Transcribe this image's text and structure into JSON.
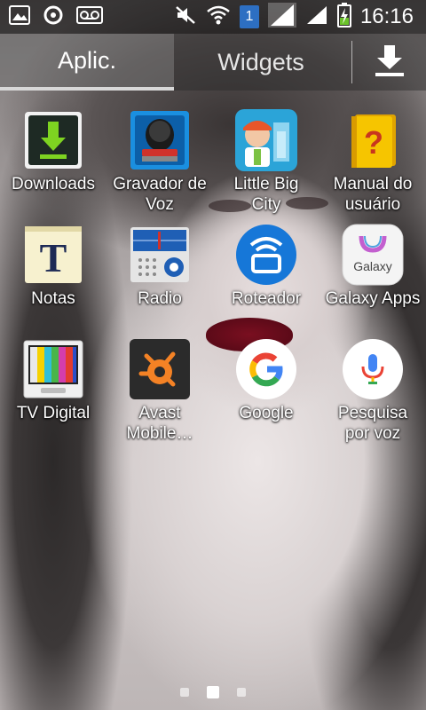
{
  "status_bar": {
    "time": "16:16",
    "sim_slot": "1",
    "icons": [
      "gallery-icon",
      "sync-icon",
      "voicemail-icon",
      "mute-icon",
      "wifi-icon",
      "signal-icon",
      "battery-charging-icon"
    ]
  },
  "tabs": {
    "apps": "Aplic.",
    "widgets": "Widgets",
    "download_icon": "download-icon"
  },
  "apps": [
    {
      "label": "Downloads",
      "icon": "downloads-icon"
    },
    {
      "label": "Gravador de\nVoz",
      "icon": "voice-recorder-icon"
    },
    {
      "label": "Little Big\nCity",
      "icon": "little-big-city-icon"
    },
    {
      "label": "Manual do\nusuário",
      "icon": "manual-icon"
    },
    {
      "label": "Notas",
      "icon": "notes-icon"
    },
    {
      "label": "Radio",
      "icon": "radio-icon"
    },
    {
      "label": "Roteador",
      "icon": "router-icon"
    },
    {
      "label": "Galaxy Apps",
      "icon": "galaxy-apps-icon"
    },
    {
      "label": "TV Digital",
      "icon": "tv-digital-icon"
    },
    {
      "label": "Avast\nMobile…",
      "icon": "avast-icon"
    },
    {
      "label": "Google",
      "icon": "google-icon"
    },
    {
      "label": "Pesquisa\npor voz",
      "icon": "voice-search-icon"
    }
  ],
  "icon_text": {
    "notes_letter": "T",
    "manual_letter": "?",
    "galaxy_text": "Galaxy"
  },
  "pager": {
    "pages": 3,
    "current": 2
  },
  "colors": {
    "tab_bg": "#282828",
    "sim_badge": "#2d6fc2",
    "downloads_green": "#6ac12a",
    "google_blue": "#4285f4",
    "avast_orange": "#f48225"
  }
}
